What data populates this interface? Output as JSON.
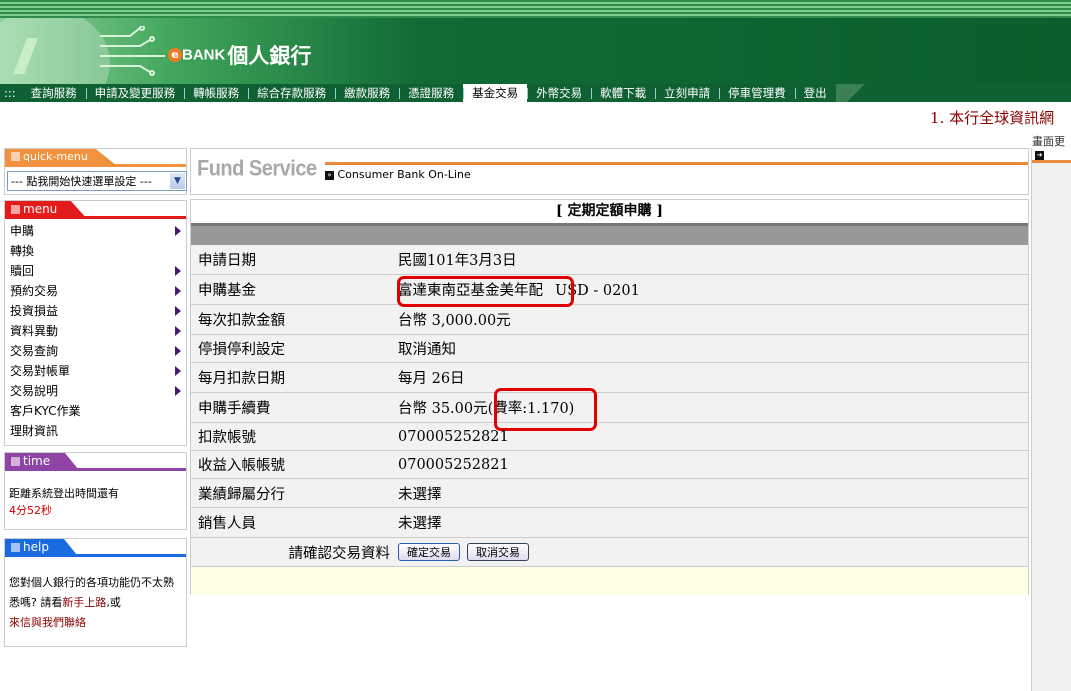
{
  "header": {
    "brand_e": "e",
    "brand_bank": "BANK",
    "brand_title": "個人銀行"
  },
  "nav": {
    "dots": ":::",
    "items": [
      "查詢服務",
      "申請及變更服務",
      "轉帳服務",
      "綜合存款服務",
      "繳款服務",
      "憑證服務",
      "基金交易",
      "外幣交易",
      "軟體下載",
      "立刻申請",
      "停車管理費",
      "登出"
    ],
    "active": "基金交易"
  },
  "marquee": "1. 本行全球資訊網",
  "right_panel": {
    "label": "畫面更"
  },
  "quick_menu": {
    "title": "quick-menu",
    "select_value": "--- 點我開始快速選單設定 ---"
  },
  "menu": {
    "title": "menu",
    "items": [
      {
        "label": "申購",
        "submenu": true
      },
      {
        "label": "轉換",
        "submenu": false
      },
      {
        "label": "贖回",
        "submenu": true
      },
      {
        "label": "預約交易",
        "submenu": true
      },
      {
        "label": "投資損益",
        "submenu": true
      },
      {
        "label": "資料異動",
        "submenu": true
      },
      {
        "label": "交易查詢",
        "submenu": true
      },
      {
        "label": "交易對帳單",
        "submenu": true
      },
      {
        "label": "交易說明",
        "submenu": true
      },
      {
        "label": "客戶KYC作業",
        "submenu": false
      },
      {
        "label": "理財資訊",
        "submenu": false
      }
    ]
  },
  "time": {
    "title": "time",
    "text": "距離系統登出時間還有",
    "remaining": "4分52秒"
  },
  "help": {
    "title": "help",
    "text1": "您對個人銀行的各項功能仍不太熟悉嗎? 請看",
    "link1": "新手上路",
    "text2": ",或",
    "link2": "來信與我們聯絡"
  },
  "fund_header": {
    "logo": "Fund Service",
    "subtitle": "Consumer Bank On-Line"
  },
  "form": {
    "title": "[ 定期定額申購 ]",
    "rows": [
      {
        "label": "申請日期",
        "value": "民國101年3月3日"
      },
      {
        "label": "申購基金",
        "value": "富達東南亞基金美年配",
        "extra": "USD - 0201"
      },
      {
        "label": "每次扣款金額",
        "value": "台幣 3,000.00元"
      },
      {
        "label": "停損停利設定",
        "value": "取消通知"
      },
      {
        "label": "每月扣款日期",
        "value": "每月 26日"
      },
      {
        "label": "申購手續費",
        "value": "台幣 35.00元",
        "extra": "(費率:1.170)"
      },
      {
        "label": "扣款帳號",
        "value": "070005252821"
      },
      {
        "label": "收益入帳帳號",
        "value": "070005252821"
      },
      {
        "label": "業績歸屬分行",
        "value": "未選擇"
      },
      {
        "label": "銷售人員",
        "value": "未選擇"
      }
    ],
    "confirm_prompt": "請確認交易資料",
    "confirm_button": "確定交易",
    "cancel_button": "取消交易"
  },
  "colors": {
    "brand_green": "#0f6134",
    "highlight": "#e00000",
    "orange": "#e98a3c",
    "menu_red": "#e31b1b",
    "time_purple": "#8e44a5",
    "help_blue": "#1a6ae0"
  }
}
